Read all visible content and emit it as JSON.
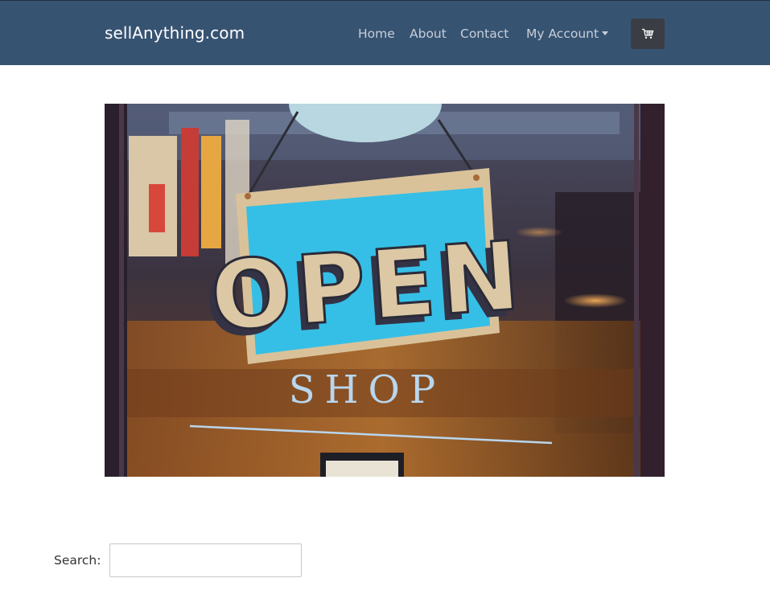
{
  "brand": "sellAnything.com",
  "nav": {
    "home": "Home",
    "about": "About",
    "contact": "Contact",
    "account": "My Account",
    "cart_icon": "shopping-cart-icon"
  },
  "hero": {
    "sign_text": "OPEN",
    "window_text": "SHOP"
  },
  "search": {
    "label": "Search:",
    "value": ""
  },
  "colors": {
    "navbar": "#375372",
    "brand_text": "#ffffff",
    "nav_text": "#c7cfd9",
    "cart_button": "#3a3e44"
  }
}
